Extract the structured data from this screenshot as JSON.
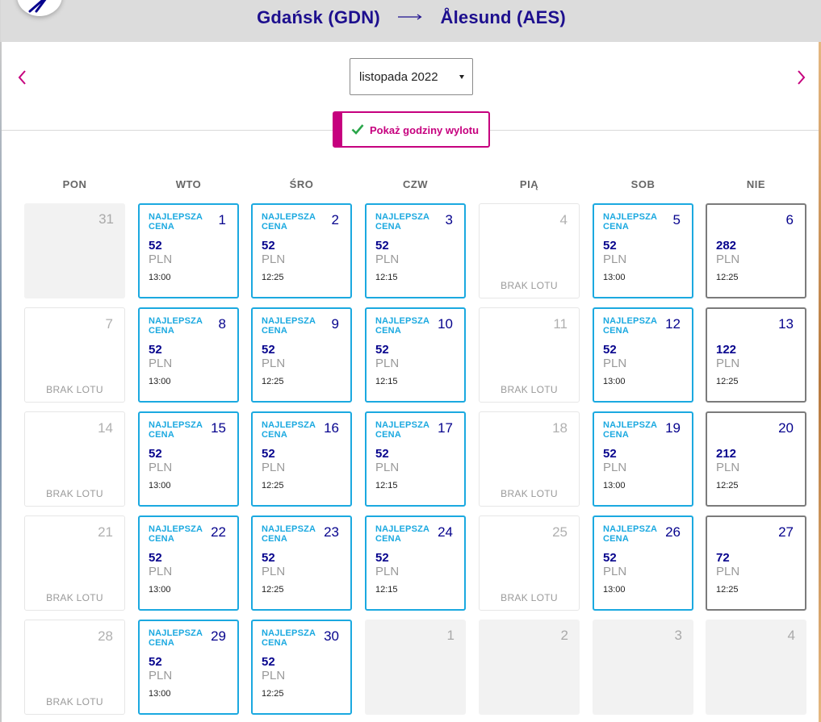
{
  "header": {
    "origin": "Gdańsk (GDN)",
    "destination": "Ålesund (AES)"
  },
  "month_select": {
    "value": "listopada 2022"
  },
  "show_times": {
    "label": "Pokaż godziny wylotu"
  },
  "weekdays": [
    "PON",
    "WTO",
    "ŚRO",
    "CZW",
    "PIĄ",
    "SOB",
    "NIE"
  ],
  "labels": {
    "best": "NAJLEPSZA CENA",
    "currency": "PLN",
    "no_flight": "BRAK LOTU"
  },
  "colors": {
    "brand_navy": "#06038d",
    "accent_magenta": "#c6007e",
    "best_price_blue": "#1ba9e0"
  },
  "weeks": [
    [
      {
        "day": "31",
        "type": "empty"
      },
      {
        "day": "1",
        "type": "best",
        "price": "52",
        "time": "13:00"
      },
      {
        "day": "2",
        "type": "best",
        "price": "52",
        "time": "12:25"
      },
      {
        "day": "3",
        "type": "best",
        "price": "52",
        "time": "12:15"
      },
      {
        "day": "4",
        "type": "noflight"
      },
      {
        "day": "5",
        "type": "best",
        "price": "52",
        "time": "13:00"
      },
      {
        "day": "6",
        "type": "normal",
        "price": "282",
        "time": "12:25"
      }
    ],
    [
      {
        "day": "7",
        "type": "noflight"
      },
      {
        "day": "8",
        "type": "best",
        "price": "52",
        "time": "13:00"
      },
      {
        "day": "9",
        "type": "best",
        "price": "52",
        "time": "12:25"
      },
      {
        "day": "10",
        "type": "best",
        "price": "52",
        "time": "12:15"
      },
      {
        "day": "11",
        "type": "noflight"
      },
      {
        "day": "12",
        "type": "best",
        "price": "52",
        "time": "13:00"
      },
      {
        "day": "13",
        "type": "normal",
        "price": "122",
        "time": "12:25"
      }
    ],
    [
      {
        "day": "14",
        "type": "noflight"
      },
      {
        "day": "15",
        "type": "best",
        "price": "52",
        "time": "13:00"
      },
      {
        "day": "16",
        "type": "best",
        "price": "52",
        "time": "12:25"
      },
      {
        "day": "17",
        "type": "best",
        "price": "52",
        "time": "12:15"
      },
      {
        "day": "18",
        "type": "noflight"
      },
      {
        "day": "19",
        "type": "best",
        "price": "52",
        "time": "13:00"
      },
      {
        "day": "20",
        "type": "normal",
        "price": "212",
        "time": "12:25"
      }
    ],
    [
      {
        "day": "21",
        "type": "noflight"
      },
      {
        "day": "22",
        "type": "best",
        "price": "52",
        "time": "13:00"
      },
      {
        "day": "23",
        "type": "best",
        "price": "52",
        "time": "12:25"
      },
      {
        "day": "24",
        "type": "best",
        "price": "52",
        "time": "12:15"
      },
      {
        "day": "25",
        "type": "noflight"
      },
      {
        "day": "26",
        "type": "best",
        "price": "52",
        "time": "13:00"
      },
      {
        "day": "27",
        "type": "normal",
        "price": "72",
        "time": "12:25"
      }
    ],
    [
      {
        "day": "28",
        "type": "noflight"
      },
      {
        "day": "29",
        "type": "best",
        "price": "52",
        "time": "13:00"
      },
      {
        "day": "30",
        "type": "best",
        "price": "52",
        "time": "12:25"
      },
      {
        "day": "1",
        "type": "empty"
      },
      {
        "day": "2",
        "type": "empty"
      },
      {
        "day": "3",
        "type": "empty"
      },
      {
        "day": "4",
        "type": "empty"
      }
    ]
  ]
}
